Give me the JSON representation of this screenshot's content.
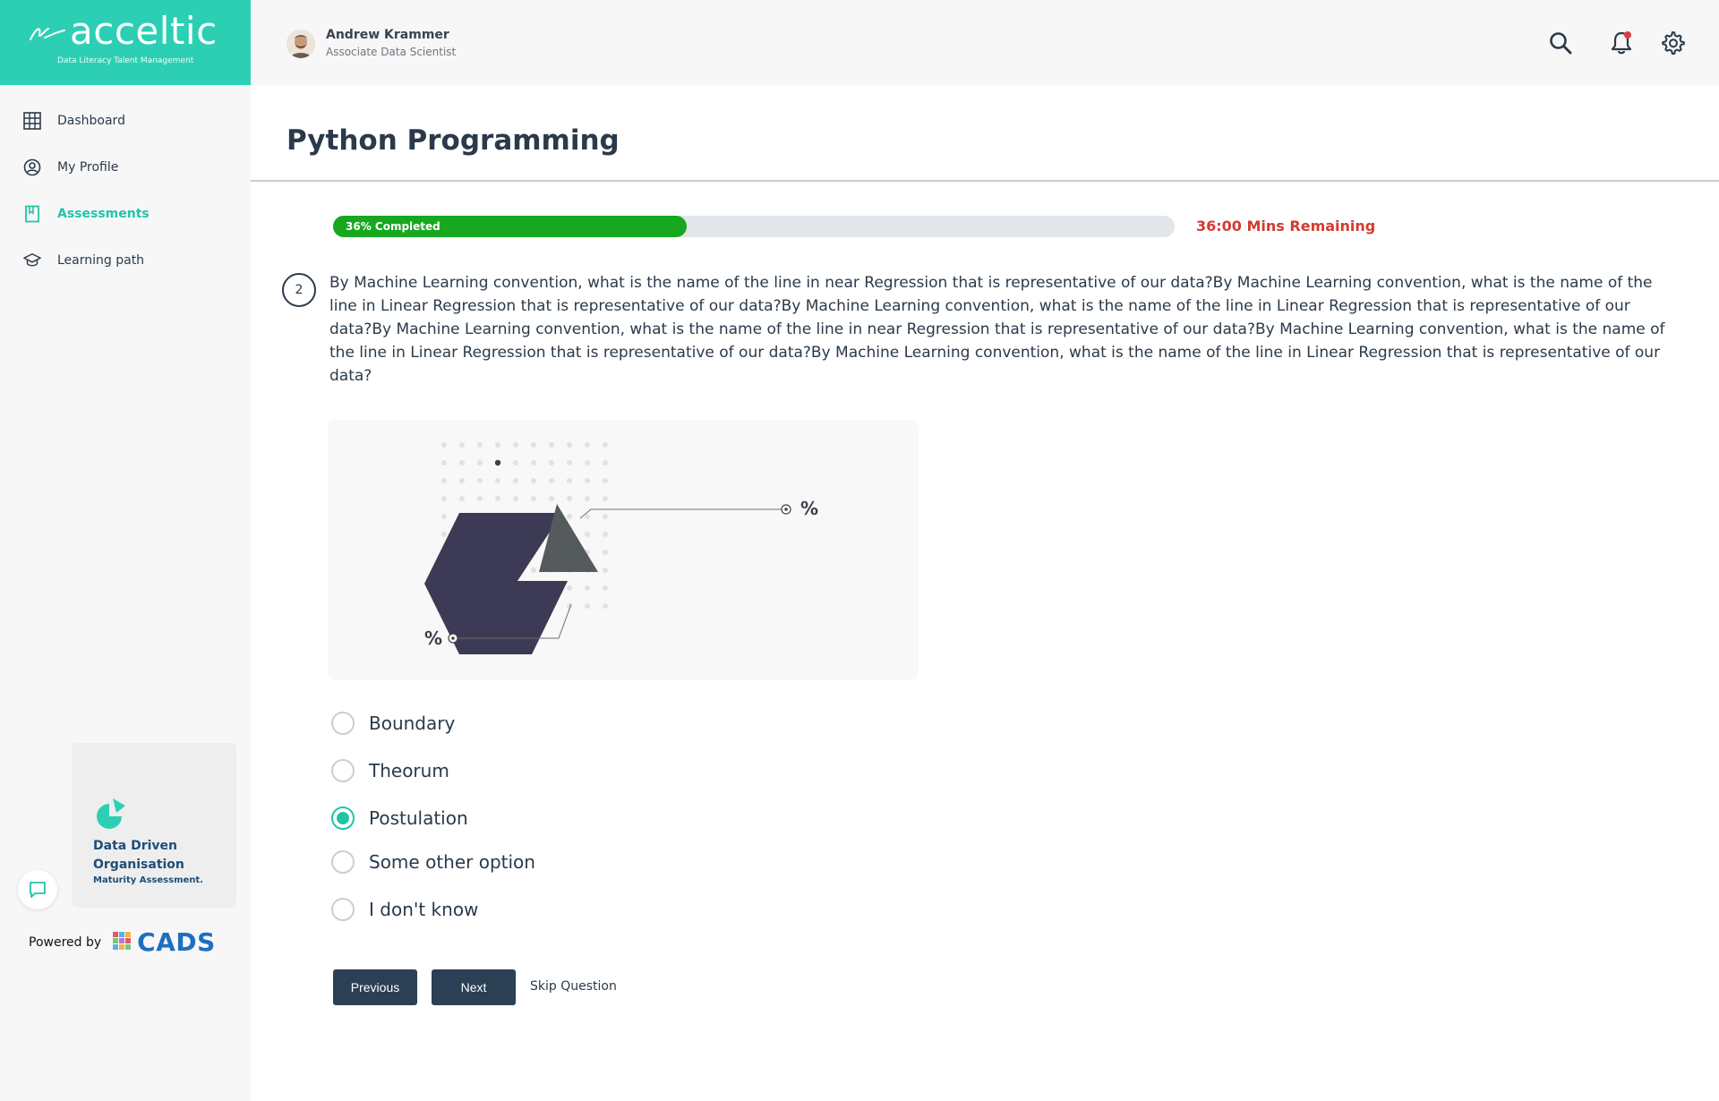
{
  "brand": {
    "name": "acceltic",
    "tagline": "Data Literacy Talent Management"
  },
  "sidebar": {
    "items": [
      {
        "label": "Dashboard",
        "icon": "grid-icon",
        "active": false
      },
      {
        "label": "My Profile",
        "icon": "user-circle-icon",
        "active": false
      },
      {
        "label": "Assessments",
        "icon": "bookmark-book-icon",
        "active": true
      },
      {
        "label": "Learning path",
        "icon": "graduation-cap-icon",
        "active": false
      }
    ],
    "promo": {
      "title": "Data Driven Organisation",
      "subtitle": "Maturity Assessment."
    },
    "powered_by": {
      "label": "Powered by",
      "brand": "CADS"
    }
  },
  "header": {
    "user_name": "Andrew Krammer",
    "user_role": "Associate Data Scientist",
    "icons": [
      "search-icon",
      "bell-icon",
      "gear-icon"
    ]
  },
  "page": {
    "title": "Python Programming"
  },
  "progress": {
    "percent": 0.42,
    "label": "36% Completed",
    "time_remaining": "36:00 Mins Remaining"
  },
  "question": {
    "number": "2",
    "text": "By Machine Learning convention, what is the name of the line in near Regression that is representative of our data?By Machine Learning convention, what is the name of the line in Linear Regression that is representative of our data?By Machine Learning convention, what is the name of the line in Linear Regression that is representative of our data?By Machine Learning convention, what is the name of the line in near Regression that is representative of our data?By Machine Learning convention, what is the name of the line in Linear Regression that is representative of our data?By Machine Learning convention, what is the name of the line in Linear Regression that is representative of our data?",
    "figure_labels": {
      "top_right": "%",
      "bottom_left": "%"
    },
    "options": [
      {
        "label": "Boundary",
        "selected": false
      },
      {
        "label": "Theorum",
        "selected": false
      },
      {
        "label": "Postulation",
        "selected": true
      },
      {
        "label": "Some other option",
        "selected": false
      },
      {
        "label": "I don't know",
        "selected": false
      }
    ]
  },
  "actions": {
    "previous": "Previous",
    "next": "Next",
    "skip": "Skip Question"
  },
  "colors": {
    "brand": "#2dcfb4",
    "accent": "#22c4a8",
    "progress": "#17a81f",
    "warning": "#d43b2f",
    "button": "#2b3f55",
    "promo_text": "#1d4e7a"
  }
}
